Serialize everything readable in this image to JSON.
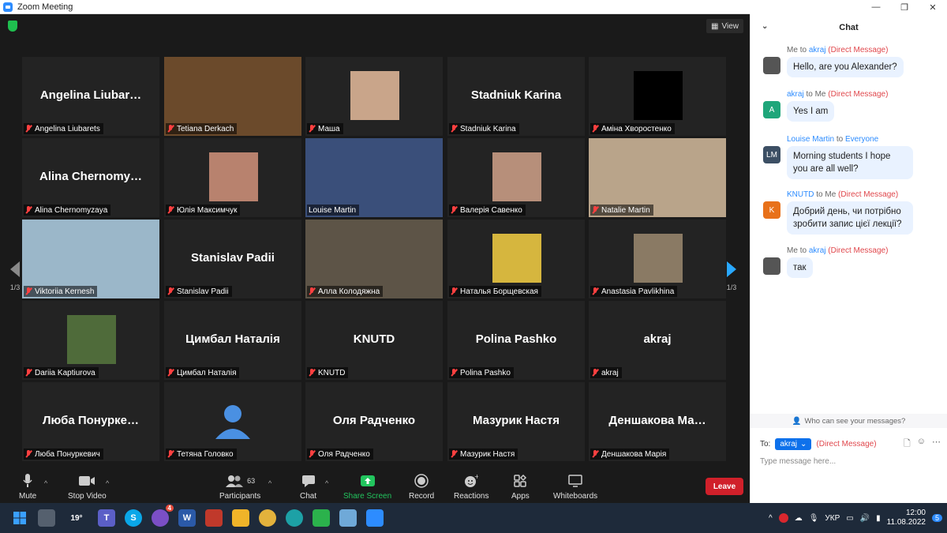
{
  "window": {
    "title": "Zoom Meeting"
  },
  "meeting": {
    "view_label": "View",
    "page_left": "1/3",
    "page_right": "1/3",
    "tiles": [
      {
        "name": "Angelina Liubarets",
        "big": "Angelina  Liubar…",
        "kind": "text"
      },
      {
        "name": "Tetiana Derkach",
        "kind": "video",
        "bg": "#6b4a2b"
      },
      {
        "name": "Маша",
        "kind": "photo",
        "bg": "#c9a58a"
      },
      {
        "name": "Stadniuk Karina",
        "big": "Stadniuk Karina",
        "kind": "text"
      },
      {
        "name": "Аміна Хворостенко",
        "kind": "black"
      },
      {
        "name": "Alina Chernomyzaya",
        "big": "Alina  Chernomy…",
        "kind": "text"
      },
      {
        "name": "Юлія Максимчук",
        "kind": "photo",
        "bg": "#b8826e"
      },
      {
        "name": "Louise Martin",
        "kind": "video",
        "bg": "#3a4f7a",
        "active": true
      },
      {
        "name": "Валерія Савенко",
        "kind": "photo",
        "bg": "#b78f7a"
      },
      {
        "name": "Natalie Martin",
        "kind": "video",
        "bg": "#b9a48a"
      },
      {
        "name": "Viktoriia Kernesh",
        "kind": "video",
        "bg": "#9bb7c9"
      },
      {
        "name": "Stanislav Padii",
        "big": "Stanislav Padii",
        "kind": "text"
      },
      {
        "name": "Алла Колодяжна",
        "kind": "video",
        "bg": "#5d5447"
      },
      {
        "name": "Наталья Борщевская",
        "kind": "photo",
        "bg": "#d6b63e"
      },
      {
        "name": "Anastasia Pavlikhina",
        "kind": "photo",
        "bg": "#8a7a64"
      },
      {
        "name": "Dariia Kaptiurova",
        "kind": "photo",
        "bg": "#4f6b3a"
      },
      {
        "name": "Цимбал Наталія",
        "big": "Цимбал Наталія",
        "kind": "text"
      },
      {
        "name": "KNUTD",
        "big": "KNUTD",
        "kind": "text"
      },
      {
        "name": "Polina Pashko",
        "big": "Polina Pashko",
        "kind": "text"
      },
      {
        "name": "akraj",
        "big": "akraj",
        "kind": "text"
      },
      {
        "name": "Люба Понуркевич",
        "big": "Люба  Понурке…",
        "kind": "text"
      },
      {
        "name": "Тетяна Головко",
        "kind": "avatar"
      },
      {
        "name": "Оля Радченко",
        "big": "Оля Радченко",
        "kind": "text"
      },
      {
        "name": "Мазурик Настя",
        "big": "Мазурик Настя",
        "kind": "text"
      },
      {
        "name": "Деншакова Марія",
        "big": "Деншакова  Ма…",
        "kind": "text"
      }
    ]
  },
  "toolbar": {
    "mute": "Mute",
    "stop_video": "Stop Video",
    "participants": "Participants",
    "participants_count": "63",
    "chat": "Chat",
    "share_screen": "Share Screen",
    "record": "Record",
    "reactions": "Reactions",
    "apps": "Apps",
    "whiteboards": "Whiteboards",
    "leave": "Leave"
  },
  "chat": {
    "title": "Chat",
    "messages": [
      {
        "from": "Me",
        "to": "akraj",
        "dm": "(Direct Message)",
        "text": "Hello, are you Alexander?",
        "avatar": "",
        "avatar_color": "#555555"
      },
      {
        "from": "akraj",
        "to": "Me",
        "dm": "(Direct Message)",
        "text": "Yes I am",
        "avatar": "A",
        "avatar_color": "#1fa67a"
      },
      {
        "from": "Louise Martin",
        "to": "Everyone",
        "dm": "",
        "text": "Morning students I hope you are all well?",
        "avatar": "LM",
        "avatar_color": "#3c4f64"
      },
      {
        "from": "KNUTD",
        "to": "Me",
        "dm": "(Direct Message)",
        "text": "Добрий день, чи потрібно зробити запис цієї лекції?",
        "avatar": "K",
        "avatar_color": "#e8711a"
      },
      {
        "from": "Me",
        "to": "akraj",
        "dm": "(Direct Message)",
        "text": "так",
        "avatar": "",
        "avatar_color": "#555555"
      }
    ],
    "to_word": "to",
    "who_can_see": "Who can see your messages?",
    "to_label": "To:",
    "recipient": "akraj",
    "recipient_dm": "(Direct Message)",
    "input_placeholder": "Type message here..."
  },
  "taskbar": {
    "weather": "19°",
    "viber_badge": "4",
    "lang": "УКР",
    "time": "12:00",
    "date": "11.08.2022",
    "notif_count": "5"
  }
}
